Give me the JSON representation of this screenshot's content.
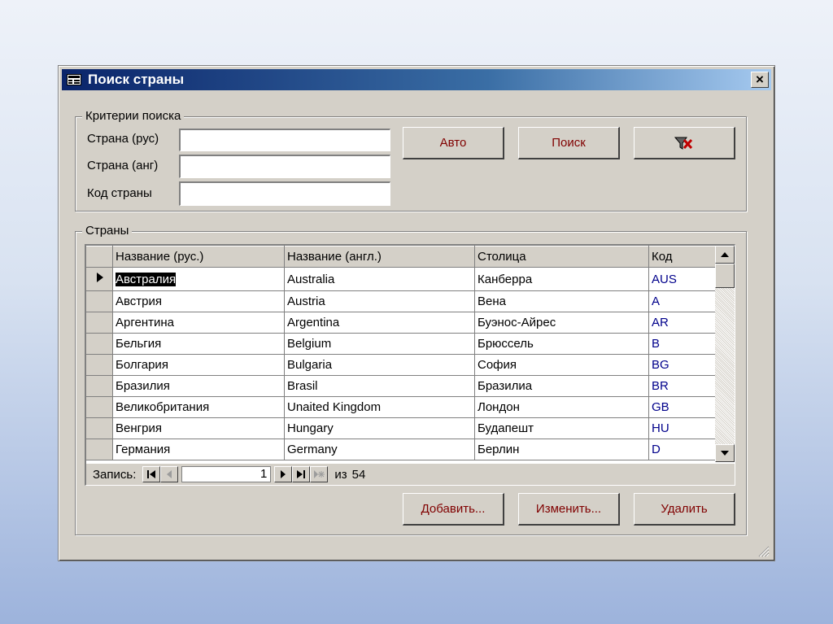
{
  "window": {
    "title": "Поиск страны",
    "close_glyph": "×"
  },
  "criteria": {
    "legend": "Критерии поиска",
    "fields": [
      {
        "label": "Страна (рус)",
        "value": ""
      },
      {
        "label": "Страна (анг)",
        "value": ""
      },
      {
        "label": "Код страны",
        "value": ""
      }
    ],
    "buttons": {
      "auto": "Авто",
      "search": "Поиск",
      "clear_icon": "filter-clear-icon"
    }
  },
  "countries": {
    "legend": "Страны",
    "columns": [
      "Название (рус.)",
      "Название (англ.)",
      "Столица",
      "Код"
    ],
    "rows": [
      [
        "Австралия",
        "Australia",
        "Канберра",
        "AUS"
      ],
      [
        "Австрия",
        "Austria",
        "Вена",
        "A"
      ],
      [
        "Аргентина",
        "Argentina",
        "Буэнос-Айрес",
        "AR"
      ],
      [
        "Бельгия",
        "Belgium",
        "Брюссель",
        "B"
      ],
      [
        "Болгария",
        "Bulgaria",
        "София",
        "BG"
      ],
      [
        "Бразилия",
        "Brasil",
        "Бразилиа",
        "BR"
      ],
      [
        "Великобритания",
        "Unaited Kingdom",
        "Лондон",
        "GB"
      ],
      [
        "Венгрия",
        "Hungary",
        "Будапешт",
        "HU"
      ],
      [
        "Германия",
        "Germany",
        "Берлин",
        "D"
      ]
    ],
    "selected_row": 0,
    "navigator": {
      "label": "Запись:",
      "current": "1",
      "of_label": "из",
      "total": "54"
    }
  },
  "actions": {
    "add": "Добавить...",
    "edit": "Изменить...",
    "delete": "Удалить"
  },
  "colors": {
    "title_start": "#0a246a",
    "title_end": "#a6caf0",
    "face": "#d4d0c8",
    "button_text": "#800000",
    "code_text": "#00008b"
  }
}
